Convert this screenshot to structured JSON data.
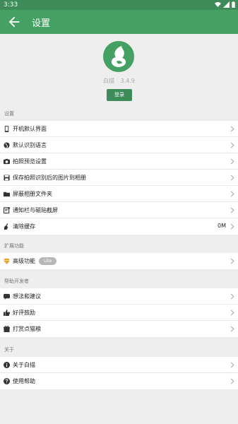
{
  "status_bar": {
    "time": "3:33"
  },
  "app_bar": {
    "title": "设置"
  },
  "about_header": {
    "app_name": "白描",
    "version": "3.4.9",
    "login_label": "登录"
  },
  "sections": [
    {
      "label": "设置",
      "items": [
        {
          "icon": "phone-icon",
          "label": "开机默认界面",
          "value": ""
        },
        {
          "icon": "globe-icon",
          "label": "默认识别语言",
          "value": ""
        },
        {
          "icon": "camera-icon",
          "label": "拍照预览设置",
          "value": ""
        },
        {
          "icon": "save-icon",
          "label": "保存拍照识别后的图片到相册",
          "value": ""
        },
        {
          "icon": "folder-icon",
          "label": "屏蔽相册文件夹",
          "value": ""
        },
        {
          "icon": "notification-icon",
          "label": "通知栏与磁贴截屏",
          "value": ""
        },
        {
          "icon": "broom-icon",
          "label": "清除缓存",
          "value": "0M"
        }
      ]
    },
    {
      "label": "扩展功能",
      "items": [
        {
          "icon": "diamond-icon",
          "label": "高级功能",
          "badge": "Lite",
          "value": ""
        }
      ]
    },
    {
      "label": "帮助开发者",
      "items": [
        {
          "icon": "chat-icon",
          "label": "想法和建议",
          "value": ""
        },
        {
          "icon": "thumbs-up-icon",
          "label": "好评鼓励",
          "value": ""
        },
        {
          "icon": "gift-icon",
          "label": "打赏点猫粮",
          "value": ""
        }
      ]
    },
    {
      "label": "关于",
      "items": [
        {
          "icon": "info-icon",
          "label": "关于白描",
          "value": ""
        },
        {
          "icon": "help-icon",
          "label": "使用帮助",
          "value": ""
        }
      ]
    }
  ]
}
